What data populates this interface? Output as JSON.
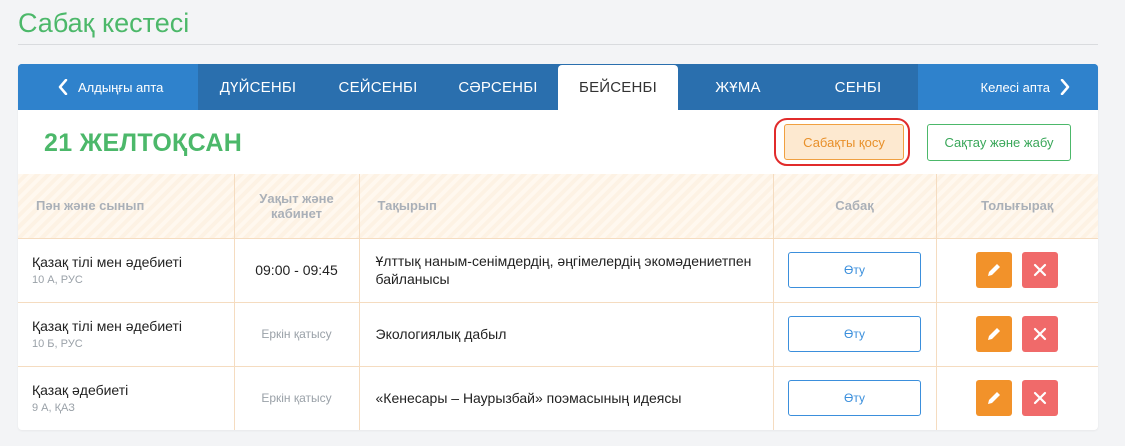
{
  "page": {
    "title": "Сабақ кестесі"
  },
  "nav": {
    "prev_label": "Алдыңғы апта",
    "next_label": "Келесі апта",
    "days": [
      "ДҮЙСЕНБІ",
      "СЕЙСЕНБІ",
      "СӘРСЕНБІ",
      "БЕЙСЕНБІ",
      "ЖҰМА",
      "СЕНБІ"
    ],
    "active_day": "БЕЙСЕНБІ"
  },
  "header": {
    "date": "21 ЖЕЛТОҚСАН",
    "add_lesson_label": "Сабақты қосу",
    "save_close_label": "Сақтау және жабу"
  },
  "table": {
    "columns": [
      "Пән және сынып",
      "Уақыт және кабинет",
      "Тақырып",
      "Сабақ",
      "Толығырақ"
    ],
    "rows": [
      {
        "subject": "Қазақ тілі мен әдебиеті",
        "class": "10 А, РУС",
        "time": "09:00 - 09:45",
        "time_muted": false,
        "topic": "Ұлттық наным-сенімдердің, әңгімелердің экомәдениетпен байланысы",
        "go_label": "Өту"
      },
      {
        "subject": "Қазақ тілі мен әдебиеті",
        "class": "10 Б, РУС",
        "time": "Еркін қатысу",
        "time_muted": true,
        "topic": "Экологиялық дабыл",
        "go_label": "Өту"
      },
      {
        "subject": "Қазақ әдебиеті",
        "class": "9 А, ҚАЗ",
        "time": "Еркін қатысу",
        "time_muted": true,
        "topic": "«Кенесары – Наурызбай» поэмасының идеясы",
        "go_label": "Өту"
      }
    ]
  },
  "colors": {
    "accent_green": "#4cb86a",
    "nav_blue": "#2f82cc",
    "highlight_red": "#e12b2b",
    "edit_orange": "#f2922a",
    "delete_red": "#f06a6a"
  }
}
